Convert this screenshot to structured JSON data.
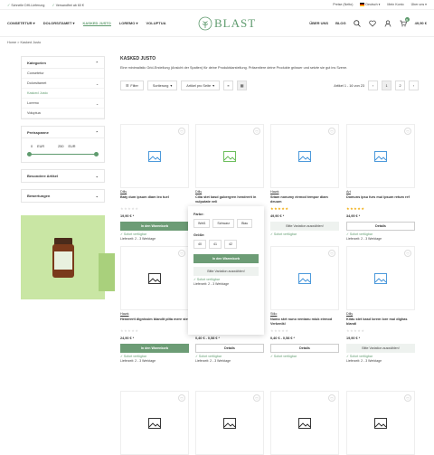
{
  "topbar": {
    "left": [
      "Schnelle DHl-Lieferung",
      "Versandfrei ab 60 €"
    ],
    "right": [
      "Preise (Netto)",
      "Deutsch",
      "Mein Konto",
      "Über uns"
    ]
  },
  "nav": [
    "CONSETETUR",
    "DOLORSITAMET",
    "KASKED JUSTO",
    "LOREMO",
    "VOLUPTUA"
  ],
  "nav_active": 2,
  "logo": "BLAST",
  "header_right": {
    "about": "ÜBER UNS",
    "blog": "BLOG",
    "cart_count": "0",
    "cart_total": "49,90 €"
  },
  "breadcrumb": "Home > Kasked Justo",
  "sidebar": {
    "categories_title": "Kategorien",
    "categories": [
      "Consetetur",
      "Dolorsitamet",
      "Kasked Justo",
      "Loremo",
      "Voluptua"
    ],
    "active_category": 2,
    "price_title": "Preisspanne",
    "price_min": "0",
    "price_max": "250",
    "currency": "EUR",
    "special_title": "Besondere Artikel",
    "reviews_title": "Bewertungen"
  },
  "main": {
    "title": "KASKED JUSTO",
    "description": "Eine minimalistic Grid-Erstellung (Ansicht der Spalten) für deine Produktdarstellung. Präsentiere deine Produkte grösser und setzte sie gut ins Szene.",
    "filter_label": "Filter",
    "sort_label": "Sortierung",
    "per_page_label": "Artikel pro Seite",
    "results_label": "Artikel 1 - 16 von 23",
    "pages": [
      "1",
      "2"
    ]
  },
  "products": [
    {
      "brand": "Dilly",
      "name": "Baty dum ipsum diam leo tuel",
      "rated": false,
      "price": "19,90 € *",
      "button": "In den Warenkorb",
      "button_style": "green",
      "avail": "Sofort verfügbar",
      "deliv": "Lieferzeit: 2 - 3 Werktage",
      "icon_color": "#3a8fd8"
    },
    {
      "brand": "Dilly",
      "name": "Cilia stet kasd gubergren hendrerit in vulputate veli",
      "rated": true,
      "price": "19,90 € *",
      "button": "",
      "button_style": "",
      "avail": "",
      "deliv": "",
      "icon_color": "#5fb84d"
    },
    {
      "brand": "Hawk",
      "name": "Sitam nonumy eirmod tempor diam deuum",
      "rated": true,
      "price": "49,90 € *",
      "button": "Bitte Variation auswählen!",
      "button_style": "grey",
      "avail": "Sofort verfügbar",
      "deliv": "",
      "icon_color": "#3a8fd8"
    },
    {
      "brand": "Art",
      "name": "Domuns ipsu furs mui ipsum retum ref",
      "rated": true,
      "price": "34,95 € *",
      "button": "Details",
      "button_style": "outline",
      "avail": "Sofort verfügbar",
      "deliv": "Lieferzeit: 2 - 3 Werktage",
      "icon_color": "#3a8fd8"
    },
    {
      "brand": "Hawk",
      "name": "Hendrerit dignissim blandit plita mere stet",
      "rated": false,
      "price": "24,90 € *",
      "button": "In den Warenkorb",
      "button_style": "green",
      "avail": "Sofort verfügbar",
      "deliv": "Lieferzeit: 2 - 3 Werktage",
      "icon_color": "#222"
    },
    {
      "brand": "Dilly",
      "name": "Numo stet nuno ventanti miuk eirmod claim",
      "rated": false,
      "price": "0,40 € - 0,58 € *",
      "button": "Details",
      "button_style": "outline",
      "avail": "Sofort verfügbar",
      "deliv": "Lieferzeit: 2 - 3 Werktage",
      "icon_color": "#222"
    },
    {
      "brand": "Stilo",
      "name": "Numo stet nuno ventanu miuk eirmod Verkenikl",
      "rated": false,
      "price": "0,40 € - 0,58 € *",
      "button": "Details",
      "button_style": "outline",
      "avail": "Sofort verfügbar",
      "deliv": "",
      "icon_color": "#3a8fd8"
    },
    {
      "brand": "Dilly",
      "name": "Kildu stet kasd lorem lore mui dighas blandi",
      "rated": false,
      "price": "19,90 € *",
      "button": "Bitte Variation auswählen!",
      "button_style": "grey",
      "avail": "Sofort verfügbar",
      "deliv": "Lieferzeit: 2 - 3 Werktage",
      "icon_color": "#3a8fd8"
    },
    {
      "icon_color": "#222"
    },
    {
      "icon_color": "#222"
    },
    {
      "icon_color": "#222"
    },
    {
      "icon_color": "#222"
    }
  ],
  "popup": {
    "color_label": "Farbe:",
    "colors": [
      "Weiß",
      "Schwarz",
      "Blau"
    ],
    "size_label": "Größe:",
    "sizes": [
      "40",
      "41",
      "42"
    ],
    "cart_button": "In den Warenkorb",
    "variation_button": "Bitte Variation auswählen!",
    "avail": "Sofort verfügbar",
    "deliv": "Lieferzeit: 2 - 3 Werktage"
  }
}
